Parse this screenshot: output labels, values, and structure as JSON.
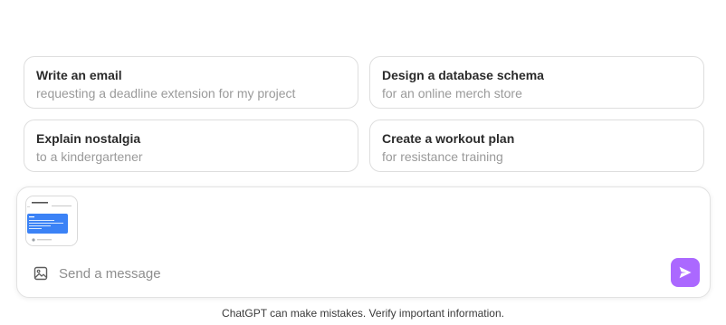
{
  "suggestions": [
    {
      "title": "Write an email",
      "subtitle": "requesting a deadline extension for my project"
    },
    {
      "title": "Design a database schema",
      "subtitle": "for an online merch store"
    },
    {
      "title": "Explain nostalgia",
      "subtitle": "to a kindergartener"
    },
    {
      "title": "Create a workout plan",
      "subtitle": "for resistance training"
    }
  ],
  "composer": {
    "placeholder": "Send a message",
    "value": "",
    "attachment_icon": "image-icon",
    "send_icon": "send-icon",
    "send_button_color": "#ab68ff"
  },
  "disclaimer": "ChatGPT can make mistakes. Verify important information."
}
